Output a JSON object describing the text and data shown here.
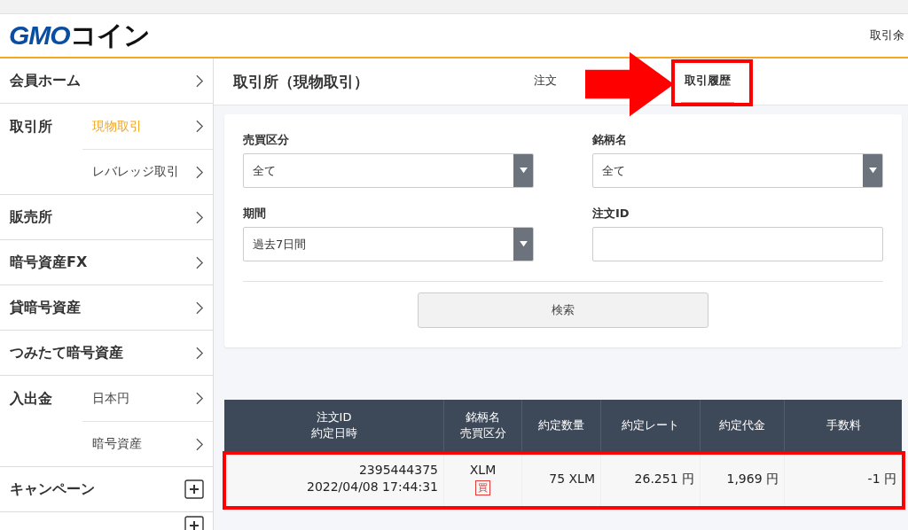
{
  "header": {
    "logo_primary": "GMO",
    "logo_secondary": "コイン",
    "right_text": "取引余"
  },
  "sidebar": {
    "items": [
      {
        "label": "会員ホーム",
        "kind": "link"
      },
      {
        "label": "取引所",
        "kind": "group",
        "children": [
          {
            "label": "現物取引",
            "selected": true
          },
          {
            "label": "レバレッジ取引",
            "selected": false
          }
        ]
      },
      {
        "label": "販売所",
        "kind": "link"
      },
      {
        "label": "暗号資産FX",
        "kind": "link"
      },
      {
        "label": "貸暗号資産",
        "kind": "link"
      },
      {
        "label": "つみたて暗号資産",
        "kind": "link"
      },
      {
        "label": "入出金",
        "kind": "group",
        "children": [
          {
            "label": "日本円",
            "selected": false
          },
          {
            "label": "暗号資産",
            "selected": false
          }
        ]
      },
      {
        "label": "キャンペーン",
        "kind": "expand"
      },
      {
        "kind": "expand"
      }
    ]
  },
  "page": {
    "title": "取引所（現物取引）",
    "tabs": [
      {
        "label": "注文",
        "selected": false
      },
      {
        "label": "取引履歴",
        "selected": true
      }
    ]
  },
  "filters": {
    "fields": [
      {
        "label": "売買区分",
        "kind": "select",
        "value": "全て"
      },
      {
        "label": "銘柄名",
        "kind": "select",
        "value": "全て"
      },
      {
        "label": "期間",
        "kind": "select",
        "value": "過去7日間"
      },
      {
        "label": "注文ID",
        "kind": "text"
      }
    ],
    "button": "検索"
  },
  "table": {
    "columns": [
      [
        "注文ID",
        "約定日時"
      ],
      [
        "銘柄名",
        "売買区分"
      ],
      [
        "約定数量"
      ],
      [
        "約定レート"
      ],
      [
        "約定代金"
      ],
      [
        "手数料"
      ]
    ],
    "rows": [
      {
        "order_id": "2395444375",
        "datetime": "2022/04/08 17:44:31",
        "symbol": "XLM",
        "side": "買",
        "quantity": "75 XLM",
        "rate": "26.251 円",
        "amount": "1,969 円",
        "fee": "-1 円"
      }
    ]
  }
}
